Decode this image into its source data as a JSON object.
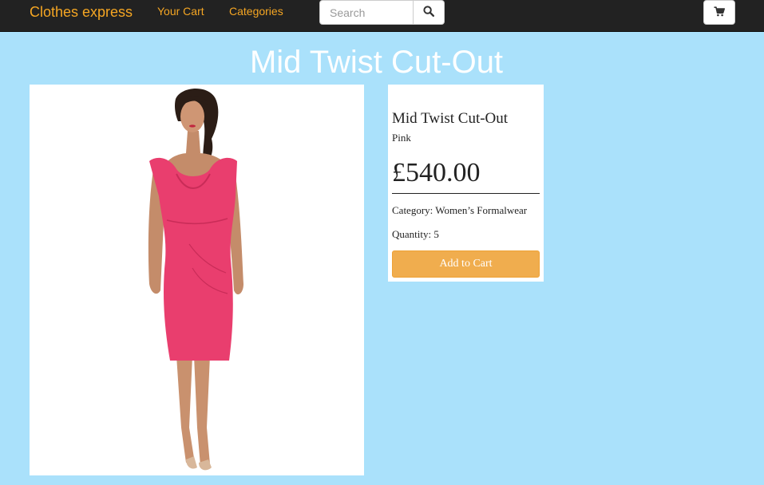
{
  "navbar": {
    "brand": "Clothes express",
    "links": [
      {
        "label": "Your Cart"
      },
      {
        "label": "Categories"
      }
    ],
    "search": {
      "placeholder": "Search",
      "value": ""
    },
    "icons": {
      "search": "search-icon",
      "cart": "cart-icon"
    },
    "accent_color": "#f5a623",
    "background_color": "#222222"
  },
  "page": {
    "title": "Mid Twist Cut-Out",
    "background_color": "#aae1fb"
  },
  "product": {
    "image_alt": "Model wearing a pink sleeveless fitted knee-length dress",
    "name": "Mid Twist Cut-Out",
    "color": "Pink",
    "price": "£540.00",
    "category": "Category: Women’s Formalwear",
    "quantity": "Quantity: 5",
    "add_to_cart_label": "Add to Cart",
    "button_color": "#f0ad4e",
    "dress_color": "#e93e6e"
  }
}
